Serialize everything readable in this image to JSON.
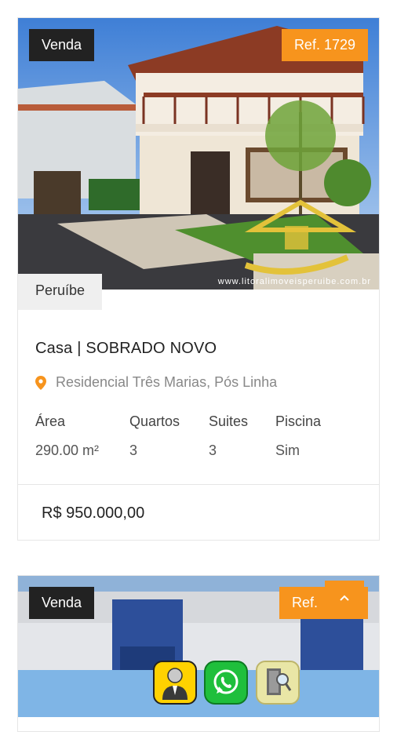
{
  "listing1": {
    "tag": "Venda",
    "ref": "Ref. 1729",
    "city": "Peruíbe",
    "title": "Casa | SOBRADO NOVO",
    "location": "Residencial Três Marias, Pós Linha",
    "watermark": "www.litoralimoveisperuibe.com.br",
    "features": [
      {
        "label": "Área",
        "value": "290.00 m²"
      },
      {
        "label": "Quartos",
        "value": "3"
      },
      {
        "label": "Suites",
        "value": "3"
      },
      {
        "label": "Piscina",
        "value": "Sim"
      }
    ],
    "price": "R$ 950.000,00"
  },
  "listing2": {
    "tag": "Venda",
    "ref": "Ref."
  },
  "floating": {
    "scroll_top_icon": "chevron-up-icon",
    "agent_icon": "agent-icon",
    "whatsapp_icon": "whatsapp-icon",
    "search_icon": "door-search-icon"
  },
  "colors": {
    "accent": "#f7941d",
    "dark_badge": "#222222",
    "whatsapp": "#1fbf3c"
  }
}
